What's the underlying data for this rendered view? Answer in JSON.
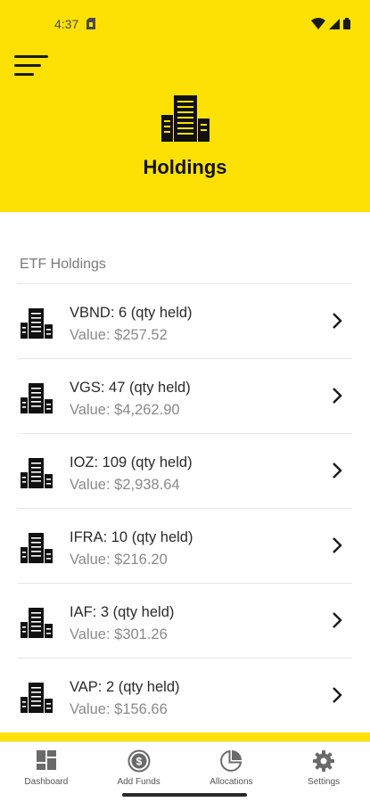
{
  "status": {
    "time": "4:37"
  },
  "header": {
    "title": "Holdings"
  },
  "section": {
    "label": "ETF Holdings"
  },
  "holdings": [
    {
      "title": "VBND: 6 (qty held)",
      "value": "Value: $257.52"
    },
    {
      "title": "VGS: 47 (qty held)",
      "value": "Value: $4,262.90"
    },
    {
      "title": "IOZ: 109 (qty held)",
      "value": "Value: $2,938.64"
    },
    {
      "title": "IFRA: 10 (qty held)",
      "value": "Value: $216.20"
    },
    {
      "title": "IAF: 3 (qty held)",
      "value": "Value: $301.26"
    },
    {
      "title": "VAP: 2 (qty held)",
      "value": "Value: $156.66"
    }
  ],
  "nav": [
    {
      "label": "Dashboard",
      "icon": "dashboard-icon"
    },
    {
      "label": "Add Funds",
      "icon": "dollar-icon"
    },
    {
      "label": "Allocations",
      "icon": "pie-chart-icon"
    },
    {
      "label": "Settings",
      "icon": "gear-icon"
    }
  ],
  "colors": {
    "accent": "#fde104",
    "text": "#1a1a1a",
    "muted": "#8a8a8a"
  }
}
